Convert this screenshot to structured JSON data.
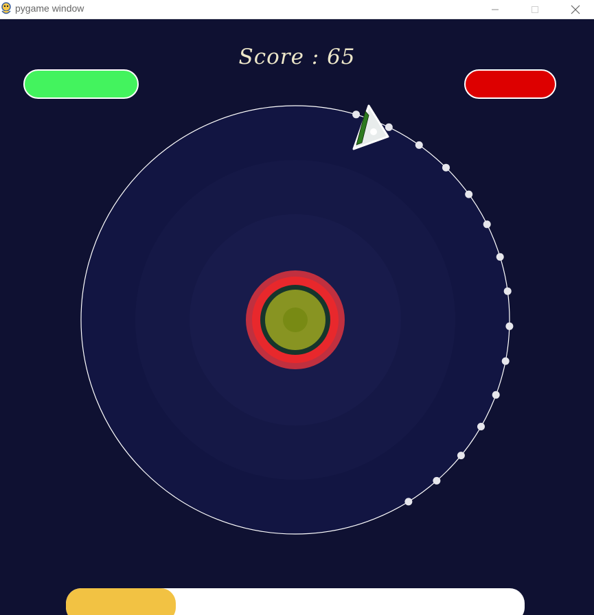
{
  "window": {
    "title": "pygame window",
    "controls": {
      "minimize": "—",
      "maximize": "☐",
      "close": "✕"
    }
  },
  "hud": {
    "score_text": "Score : 65",
    "left_indicator_color": "#43f35e",
    "right_indicator_color": "#dd0000"
  },
  "progress": {
    "fraction": 0.24,
    "fill_color": "#f2c243",
    "track_color": "#ffffff"
  },
  "arena": {
    "orbit_color": "#ffffff",
    "glow_color": "#17194a",
    "trail_dot_count": 15,
    "core": {
      "outer_ring": "#c0303f",
      "red_ring": "#e8282c",
      "dark_ring": "#16352c",
      "fill": "#889422",
      "center": "#788a14"
    },
    "ship": {
      "body_color": "#e8ecec",
      "stripe_color": "#2d7a1f",
      "outline_color": "#ffffff"
    }
  }
}
